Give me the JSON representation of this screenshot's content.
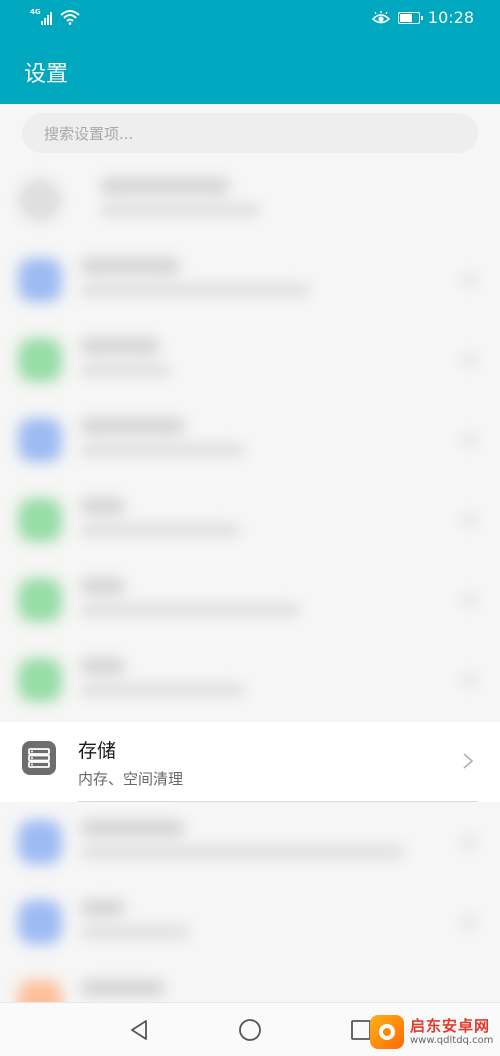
{
  "status_bar": {
    "network": "4G",
    "time": "10:28",
    "battery_level": 0.7
  },
  "app_bar": {
    "title": "设置"
  },
  "search": {
    "placeholder": "搜索设置项..."
  },
  "settings_list": {
    "visible_item": {
      "title": "存储",
      "subtitle": "内存、空间清理",
      "icon": "storage-icon"
    }
  },
  "nav_bar": {
    "buttons": [
      "back",
      "home",
      "recents"
    ]
  },
  "watermark": {
    "name": "启东安卓网",
    "url": "www.qdltdq.com"
  },
  "colors": {
    "header": "#00a8bf",
    "blurred_icon_blue": "#7fa8f2",
    "blurred_icon_green": "#78d58c",
    "blurred_icon_orange": "#ffae7a"
  }
}
